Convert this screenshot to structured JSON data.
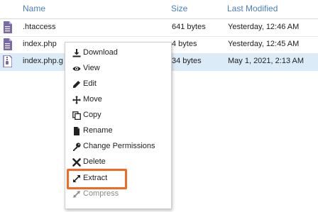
{
  "table": {
    "columns": {
      "name": "Name",
      "size": "Size",
      "modified": "Last Modified"
    },
    "rows": [
      {
        "name": ".htaccess",
        "size": "641 bytes",
        "modified": "Yesterday, 12:46 AM",
        "icon": "file-text-icon"
      },
      {
        "name": "index.php",
        "size": "4 bytes",
        "modified": "Yesterday, 12:45 AM",
        "icon": "file-text-icon"
      },
      {
        "name": "index.php.g",
        "size": "34 bytes",
        "modified": "May 1, 2021, 2:13 AM",
        "icon": "file-archive-icon",
        "selected": true
      }
    ]
  },
  "context_menu": {
    "items": [
      {
        "label": "Download",
        "icon": "download-icon"
      },
      {
        "label": "View",
        "icon": "eye-icon"
      },
      {
        "label": "Edit",
        "icon": "pencil-icon"
      },
      {
        "label": "Move",
        "icon": "move-icon"
      },
      {
        "label": "Copy",
        "icon": "copy-icon"
      },
      {
        "label": "Rename",
        "icon": "file-icon"
      },
      {
        "label": "Change Permissions",
        "icon": "key-icon"
      },
      {
        "label": "Delete",
        "icon": "close-icon"
      },
      {
        "label": "Extract",
        "icon": "expand-icon",
        "highlighted": true
      },
      {
        "label": "Compress",
        "icon": "compress-icon",
        "disabled": true
      }
    ]
  },
  "colors": {
    "header_text": "#4a7fc1",
    "selected_row": "#dcebf8",
    "highlight_box": "#f26a21",
    "file_icon": "#7a6aa8"
  }
}
